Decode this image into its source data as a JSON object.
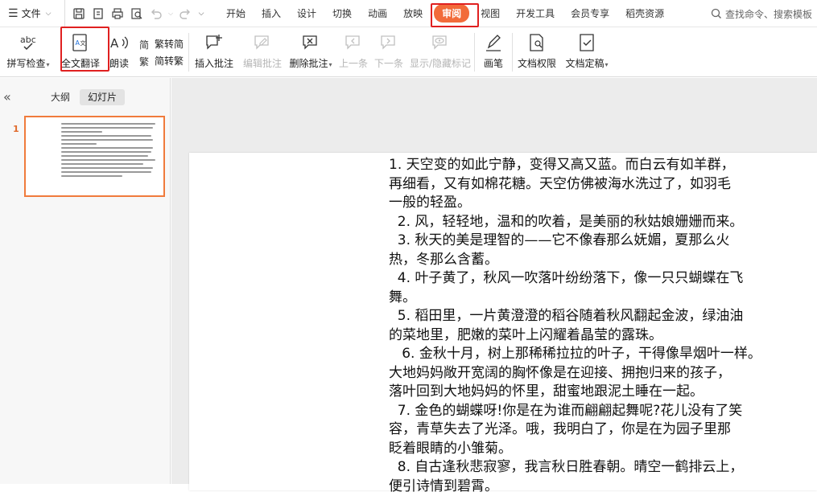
{
  "menubar": {
    "file_label": "文件",
    "tabs": [
      "开始",
      "插入",
      "设计",
      "切换",
      "动画",
      "放映",
      "审阅",
      "视图",
      "开发工具",
      "会员专享",
      "稻壳资源"
    ],
    "active_tab": "审阅",
    "search_placeholder": "查找命令、搜索模板"
  },
  "ribbon": {
    "spell_check": "拼写检查",
    "translate": "全文翻译",
    "read_aloud": "朗读",
    "trad_to_simp": "繁转简",
    "simp_to_trad": "简转繁",
    "insert_comment": "插入批注",
    "edit_comment": "编辑批注",
    "delete_comment": "删除批注",
    "prev": "上一条",
    "next": "下一条",
    "show_hide_marks": "显示/隐藏标记",
    "pen": "画笔",
    "doc_permission": "文档权限",
    "doc_finalize": "文档定稿"
  },
  "leftpane": {
    "tab_outline": "大纲",
    "tab_slides": "幻灯片",
    "slide_number": "1"
  },
  "slide": {
    "lines": [
      "1. 天空变的如此宁静，变得又高又蓝。而白云有如羊群，",
      "再细看，又有如棉花糖。天空仿佛被海水洗过了，如羽毛",
      "一般的轻盈。",
      "  2. 风，轻轻地，温和的吹着，是美丽的秋姑娘姗姗而来。",
      "  3. 秋天的美是理智的——它不像春那么妩媚，夏那么火",
      "热，冬那么含蓄。",
      "  4. 叶子黄了，秋风一吹落叶纷纷落下，像一只只蝴蝶在飞",
      "舞。",
      "  5. 稻田里，一片黄澄澄的稻谷随着秋风翻起金波，绿油油",
      "的菜地里，肥嫩的菜叶上闪耀着晶莹的露珠。",
      "   6. 金秋十月，树上那稀稀拉拉的叶子，干得像旱烟叶一样。",
      "大地妈妈敞开宽阔的胸怀像是在迎接、拥抱归来的孩子，",
      "落叶回到大地妈妈的怀里，甜蜜地跟泥土睡在一起。",
      "  7. 金色的蝴蝶呀!你是在为谁而翩翩起舞呢?花儿没有了笑",
      "容，青草失去了光泽。哦，我明白了，你是在为园子里那",
      "眨着眼睛的小雏菊。",
      "  8. 自古逢秋悲寂寥，我言秋日胜春朝。晴空一鹤排云上，",
      "便引诗情到碧霄。"
    ]
  },
  "colors": {
    "accent": "#f26b3a",
    "highlight_border": "#e02020"
  }
}
